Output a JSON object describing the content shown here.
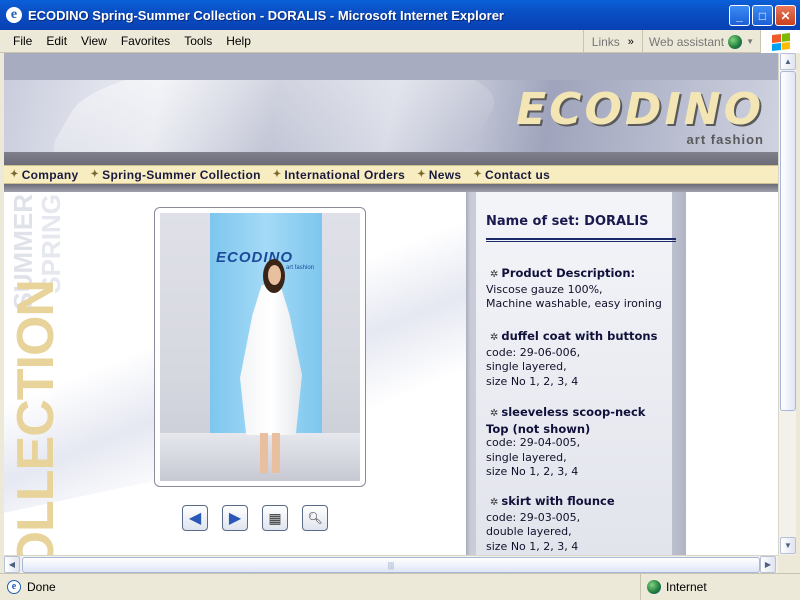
{
  "window": {
    "title": "ECODINO Spring-Summer Collection - DORALIS - Microsoft Internet Explorer"
  },
  "menu": {
    "items": [
      "File",
      "Edit",
      "View",
      "Favorites",
      "Tools",
      "Help"
    ],
    "links": "Links",
    "web_assistant": "Web assistant"
  },
  "banner": {
    "logo": "ECODINO",
    "tagline": "art fashion"
  },
  "nav": {
    "items": [
      "Company",
      "Spring-Summer Collection",
      "International Orders",
      "News",
      "Contact us"
    ]
  },
  "side": {
    "spring": "SPRING",
    "summer": "SUMMER",
    "collection": "COLLECTION"
  },
  "photo": {
    "stage_logo": "ECODINO",
    "stage_tag": "art fashion"
  },
  "info": {
    "set_name": "Name of set: DORALIS",
    "blocks": [
      {
        "title": "Product Description:",
        "lines": [
          "Viscose gauze 100%,",
          "Machine washable, easy ironing"
        ]
      },
      {
        "title": "duffel coat with buttons",
        "lines": [
          "code: 29-06-006,",
          "single layered,",
          "size No 1, 2, 3, 4"
        ]
      },
      {
        "title": "sleeveless scoop-neck",
        "title2": "Top (not shown)",
        "lines": [
          "code: 29-04-005,",
          "single layered,",
          "size No 1, 2, 3, 4"
        ]
      },
      {
        "title": "skirt with flounce",
        "lines": [
          "code: 29-03-005,",
          "double layered,",
          "size No 1, 2, 3, 4"
        ]
      }
    ]
  },
  "status": {
    "text": "Done",
    "zone": "Internet"
  }
}
